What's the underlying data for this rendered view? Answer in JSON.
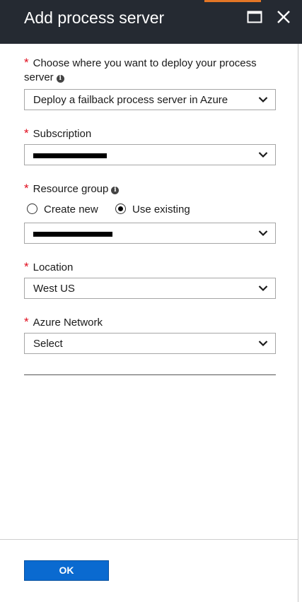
{
  "header": {
    "title": "Add process server",
    "maximize_icon": "maximize-icon",
    "close_icon": "close-icon",
    "colors": {
      "background": "#252a32",
      "accent": "#e37626"
    }
  },
  "form": {
    "deploy": {
      "required_mark": "*",
      "label_line1": "Choose where you want to deploy your process",
      "label_line2": "server",
      "info_icon": "info-icon",
      "selected": "Deploy a failback process server in Azure"
    },
    "subscription": {
      "required_mark": "*",
      "label": "Subscription",
      "selected": "[redacted]"
    },
    "resource_group": {
      "required_mark": "*",
      "label": "Resource group",
      "info_icon": "info-icon",
      "options": [
        {
          "label": "Create new",
          "checked": false
        },
        {
          "label": "Use existing",
          "checked": true
        }
      ],
      "selected": "[redacted]"
    },
    "location": {
      "required_mark": "*",
      "label": "Location",
      "selected": "West US"
    },
    "azure_network": {
      "required_mark": "*",
      "label": "Azure Network",
      "selected": "Select"
    }
  },
  "footer": {
    "ok_label": "OK",
    "button_color": "#0a6ad0"
  }
}
